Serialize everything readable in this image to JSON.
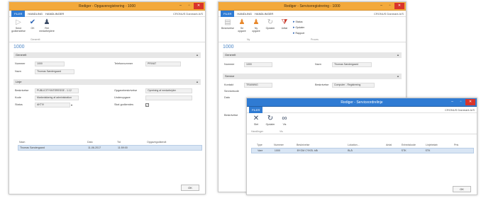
{
  "win1": {
    "title": "Rediger - Opgaveregistrering - 1000",
    "menu": {
      "file": "FILER",
      "home": "HANDLING",
      "actions": "HANDLINGER"
    },
    "company": "CRONUS Danmark A/S",
    "ribbon": {
      "btn1": "Send godkendelse",
      "btn2": "OK",
      "btn3": "Ret medarbejdere",
      "group": "Generelt"
    },
    "page_title": "1000",
    "sections": {
      "general": "Generelt",
      "line": "Linje"
    },
    "fields": {
      "no_label": "Nummer",
      "no_value": "1000",
      "name_label": "Navn",
      "name_value": "Thomas Søndergaard",
      "phone_label": "Telefonnummer",
      "phone_value": "PRIVAT",
      "desc_label": "Beskrivelse",
      "desc_value": "PUBLICITY/INTERESSE - 1.12",
      "code_label": "Kode",
      "code_value": "Markedsføring af administration",
      "status_label": "Status",
      "status_value": "AKTIV",
      "type_label": "Opgavebeskrivelse",
      "type_value": "Opretning af medarbejder",
      "sub_label": "Underopgave",
      "sub_value": "",
      "done_label": "Skal godkendes",
      "done_value": "✓"
    },
    "grid": {
      "headers": [
        "Navn",
        "Dato",
        "Tid",
        "Opgavegodkendt"
      ],
      "row": [
        "Thomas Søndergaard",
        "11-06-2017",
        "11:59:00",
        ""
      ]
    },
    "ok": "OK"
  },
  "win2": {
    "title": "Rediger - Serviceregistrering - 1000",
    "menu": {
      "file": "FILER",
      "home": "HANDLING",
      "actions": "HANDLINGER"
    },
    "company": "CRONUS Danmark A/S",
    "ribbon": {
      "b1": "Beskrivelse",
      "b2": "Se opgave",
      "b3": "Ny opgave",
      "b4": "Opdater",
      "b5": "Udfør",
      "s1": "Status",
      "s2": "Opdater",
      "s3": "Rapport",
      "group1": "Ny",
      "group2": "Proces"
    },
    "page_title": "1000",
    "sections": {
      "general": "Generelt",
      "service": "Service"
    },
    "fields": {
      "no_label": "Nummer",
      "no_value": "1000",
      "name_label": "Navn",
      "name_value": "Thomas Søndergaard",
      "contact_label": "Kontakt",
      "contact_value": "TRAINING",
      "line_label": "Beskrivelse",
      "line_value": "Computer - Registrering",
      "extra1_label": "Servicekode",
      "extra2_label": "Dato"
    },
    "side_label": "Beskrivelse"
  },
  "win3": {
    "title": "Rediger - Serviceordrelinje",
    "menu": {
      "file": "FILER"
    },
    "company": "CRONUS Danmark A/S",
    "ribbon": {
      "b1": "Slet",
      "b2": "Opdater",
      "b3": "Vis",
      "group": "Handlinger",
      "group2": "Vis"
    },
    "grid": {
      "headers": [
        "Type",
        "Nummer",
        "Beskrivelse",
        "Lokation...",
        "Antal",
        "Enhedskode",
        "Linjebeløb",
        "Pris"
      ],
      "row": [
        "Vare",
        "1000",
        "BYGM CYKEL blå",
        "BLÅ",
        "",
        "STK",
        "STK",
        ""
      ]
    },
    "ok": "OK"
  }
}
